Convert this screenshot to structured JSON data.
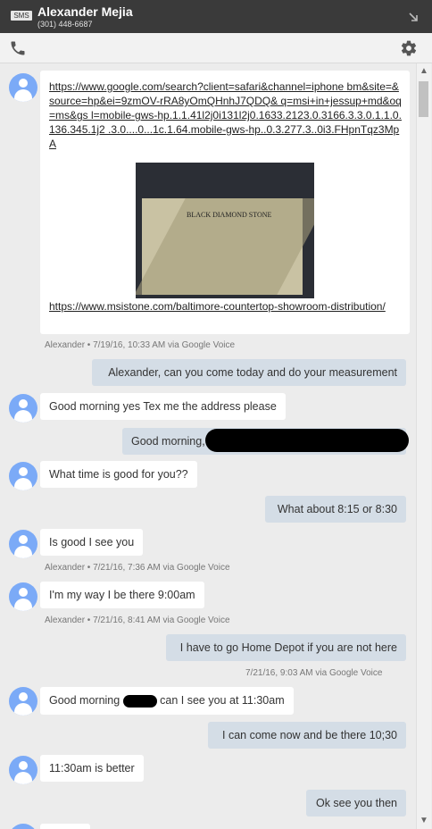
{
  "header": {
    "badge": "SMS",
    "contact_name": "Alexander Mejia",
    "contact_phone": "(301) 448-6687"
  },
  "toolbar": {
    "phone_icon": "phone-icon",
    "settings_icon": "gear-icon"
  },
  "messages": {
    "m1": {
      "url1": "https://www.google.com/search?client=safari&channel=iphone bm&site=&source=hp&ei=9zmOV-rRA8yOmQHnhJ7QDQ& q=msi+in+jessup+md&oq=ms&gs l=mobile-gws-hp.1.1.41l2j0i131l2j0.1633.2123.0.3166.3.3.0.1.1.0.136.345.1j2 .3.0....0...1c.1.64.mobile-gws-hp..0.3.277.3..0i3.FHpnTqz3MpA",
      "card_brand": "BLACK DIAMOND STONE",
      "url2": "https://www.msistone.com/baltimore-countertop-showroom-distribution/",
      "meta": "Alexander • 7/19/16, 10:33 AM  via Google Voice"
    },
    "m2": {
      "text": "Alexander, can you come today and do your measurement"
    },
    "m3": {
      "text": "Good morning yes Tex me the address please"
    },
    "m4": {
      "text": "Good morning,"
    },
    "m5": {
      "text": "What time is good for you??"
    },
    "m6": {
      "text": "What about 8:15 or 8:30"
    },
    "m7": {
      "text": "Is good I see you",
      "meta": "Alexander • 7/21/16, 7:36 AM  via Google Voice"
    },
    "m8": {
      "text": "I'm my way I be there 9:00am",
      "meta": "Alexander • 7/21/16, 8:41 AM  via Google Voice"
    },
    "m9": {
      "text": "I have to go Home Depot if you are not here",
      "meta": "7/21/16, 9:03 AM  via Google Voice"
    },
    "m10": {
      "text_a": "Good morning ",
      "text_b": " can I see you at 11:30am"
    },
    "m11": {
      "text": "I can come now and be there 10;30"
    },
    "m12": {
      "text": "11:30am is better"
    },
    "m13": {
      "text": "Ok see you then"
    }
  }
}
